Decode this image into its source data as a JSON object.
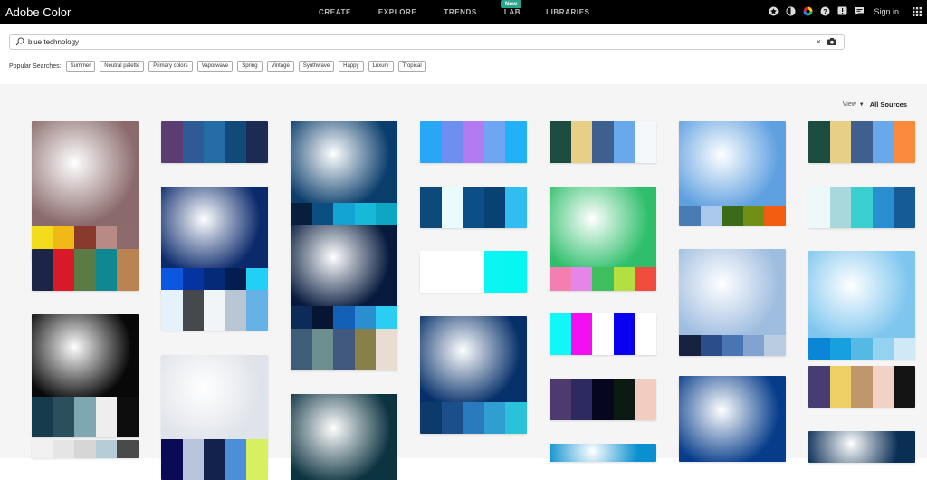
{
  "app": {
    "title": "Adobe Color",
    "nav": [
      "CREATE",
      "EXPLORE",
      "TRENDS",
      "LAB",
      "LIBRARIES"
    ],
    "new_badge": "New",
    "signin": "Sign in",
    "icons": [
      "star-icon",
      "contrast-icon",
      "color-wheel-icon",
      "help-icon",
      "alert-icon",
      "feedback-icon",
      "apps-grid-icon"
    ]
  },
  "search": {
    "value": "blue technology",
    "clear": "×"
  },
  "popular": {
    "label": "Popular Searches:",
    "chips": [
      "Summer",
      "Neutral palette",
      "Primary colors",
      "Vaporwave",
      "Spring",
      "Vintage",
      "Synthwave",
      "Happy",
      "Luxury",
      "Tropical"
    ]
  },
  "view": {
    "label": "View",
    "source": "All Sources"
  },
  "colors": {
    "accent_new": "#2aa58c",
    "topbar": "#000000",
    "gallery_bg": "#f5f5f5"
  },
  "columns": [
    [
      {
        "image": "#8a6a6a",
        "colors": [
          "#f2dc1b",
          "#f0b914",
          "#8a3a2d",
          "#b78a85",
          "#8d6a6b"
        ]
      },
      {
        "colors": [
          "#1c2448",
          "#d71a2a",
          "#5b7b45",
          "#0f8892",
          "#b9844f"
        ]
      },
      {
        "image": "#080808",
        "colors": [
          "#153b4d",
          "#2b4f5d",
          "#7fa7b1",
          "#eeeeee",
          "#0d0d0d"
        ]
      },
      {
        "colors": [
          "#f0f0f0",
          "#e5e5e5",
          "#d6d6d6",
          "#b6ccd6",
          "#4a4a4a"
        ]
      }
    ],
    [
      {
        "colors": [
          "#5b3d71",
          "#2e5a96",
          "#246ea5",
          "#114979",
          "#1d2b54"
        ]
      },
      {
        "image": "#0b2a6c",
        "colors": [
          "#0b57e0",
          "#0533a0",
          "#052a78",
          "#041d4f",
          "#21d0f5"
        ]
      },
      {
        "colors": [
          "#e5f1fb",
          "#45494d",
          "#f2f5f7",
          "#b7c6d2",
          "#66b1e6"
        ]
      },
      {
        "image": "#dfe3ea",
        "colors": [
          "#0b0b55",
          "#b8c4dc",
          "#12224d",
          "#4a8fd8",
          "#d8f060"
        ]
      }
    ],
    [
      {
        "image": "#0a3d6b",
        "colors": [
          "#071f3c",
          "#0a4e82",
          "#13a4d4",
          "#17b9d9",
          "#0da7c4"
        ]
      },
      {
        "image": "#061a3d",
        "colors": [
          "#0c2b56",
          "#061632",
          "#1361b6",
          "#2a8ed0",
          "#2bcef2"
        ]
      },
      {
        "colors": [
          "#3e5e78",
          "#6c8e8f",
          "#41597f",
          "#878049",
          "#e8ddd0"
        ]
      },
      {
        "image": "#0c3340",
        "colors": [
          "#1d3a66",
          "#6aa8e6",
          "#0aa2e6",
          "#0a5f8a",
          "#eeeeee"
        ]
      }
    ],
    [
      {
        "colors": [
          "#28a7f6",
          "#6f8ff0",
          "#b27bf2",
          "#6fa6f4",
          "#20b1f6"
        ]
      },
      {
        "colors": [
          "#0b4a7a",
          "#e9fbfd",
          "#0c4f86",
          "#084173",
          "#30bdf0"
        ]
      },
      {
        "colors": [
          "#ffffff",
          "#ffffff",
          "#ffffff",
          "#0bf6f2",
          "#06f6f2"
        ]
      },
      {
        "image": "#06306a",
        "colors": [
          "#0b3a6b",
          "#1a4f8c",
          "#2a7bbd",
          "#2f9fd1",
          "#29c2d8"
        ]
      }
    ],
    [
      {
        "colors": [
          "#1c4b40",
          "#e8cf86",
          "#3f5f8f",
          "#6aa8ec",
          "#f5f8fb"
        ]
      },
      {
        "image": "#2fbf6c",
        "colors": [
          "#f27fb0",
          "#e585e8",
          "#3fbe5d",
          "#b3e040",
          "#ef4c3d"
        ]
      },
      {
        "colors": [
          "#0ff7f7",
          "#f20ff2",
          "#ffffff",
          "#0a00f0",
          "#ffffff"
        ]
      },
      {
        "colors": [
          "#4d3b70",
          "#2d2a62",
          "#06061f",
          "#0b1a12",
          "#f3ccc0"
        ]
      },
      {
        "image": "#0a8fcf",
        "colors": []
      }
    ],
    [
      {
        "image": "#5fa0e0",
        "colors": [
          "#4a7bb5",
          "#a9c8eb",
          "#3b6a18",
          "#6f8f16",
          "#f25d12"
        ]
      },
      {
        "image": "#9fbde0",
        "colors": [
          "#15213f",
          "#2b4d8a",
          "#4a75b5",
          "#82a3cf",
          "#b9cce0"
        ]
      },
      {
        "image": "#063c8a",
        "colors": []
      }
    ],
    [
      {
        "colors": [
          "#1c4b40",
          "#e8cf86",
          "#3f5f8f",
          "#6aa8ec",
          "#fb8a3c"
        ]
      },
      {
        "colors": [
          "#edf8fb",
          "#a9d8dc",
          "#3bcfcf",
          "#2a8fd0",
          "#155c97"
        ]
      },
      {
        "image": "#7fc6ef",
        "colors": [
          "#0b86d6",
          "#16a0e0",
          "#54b9e3",
          "#93d3ef",
          "#cfeaf6"
        ]
      },
      {
        "colors": [
          "#463e72",
          "#eecf64",
          "#c0966c",
          "#f2d1c6",
          "#141414"
        ]
      },
      {
        "image": "#0a2f55",
        "colors": []
      }
    ]
  ]
}
